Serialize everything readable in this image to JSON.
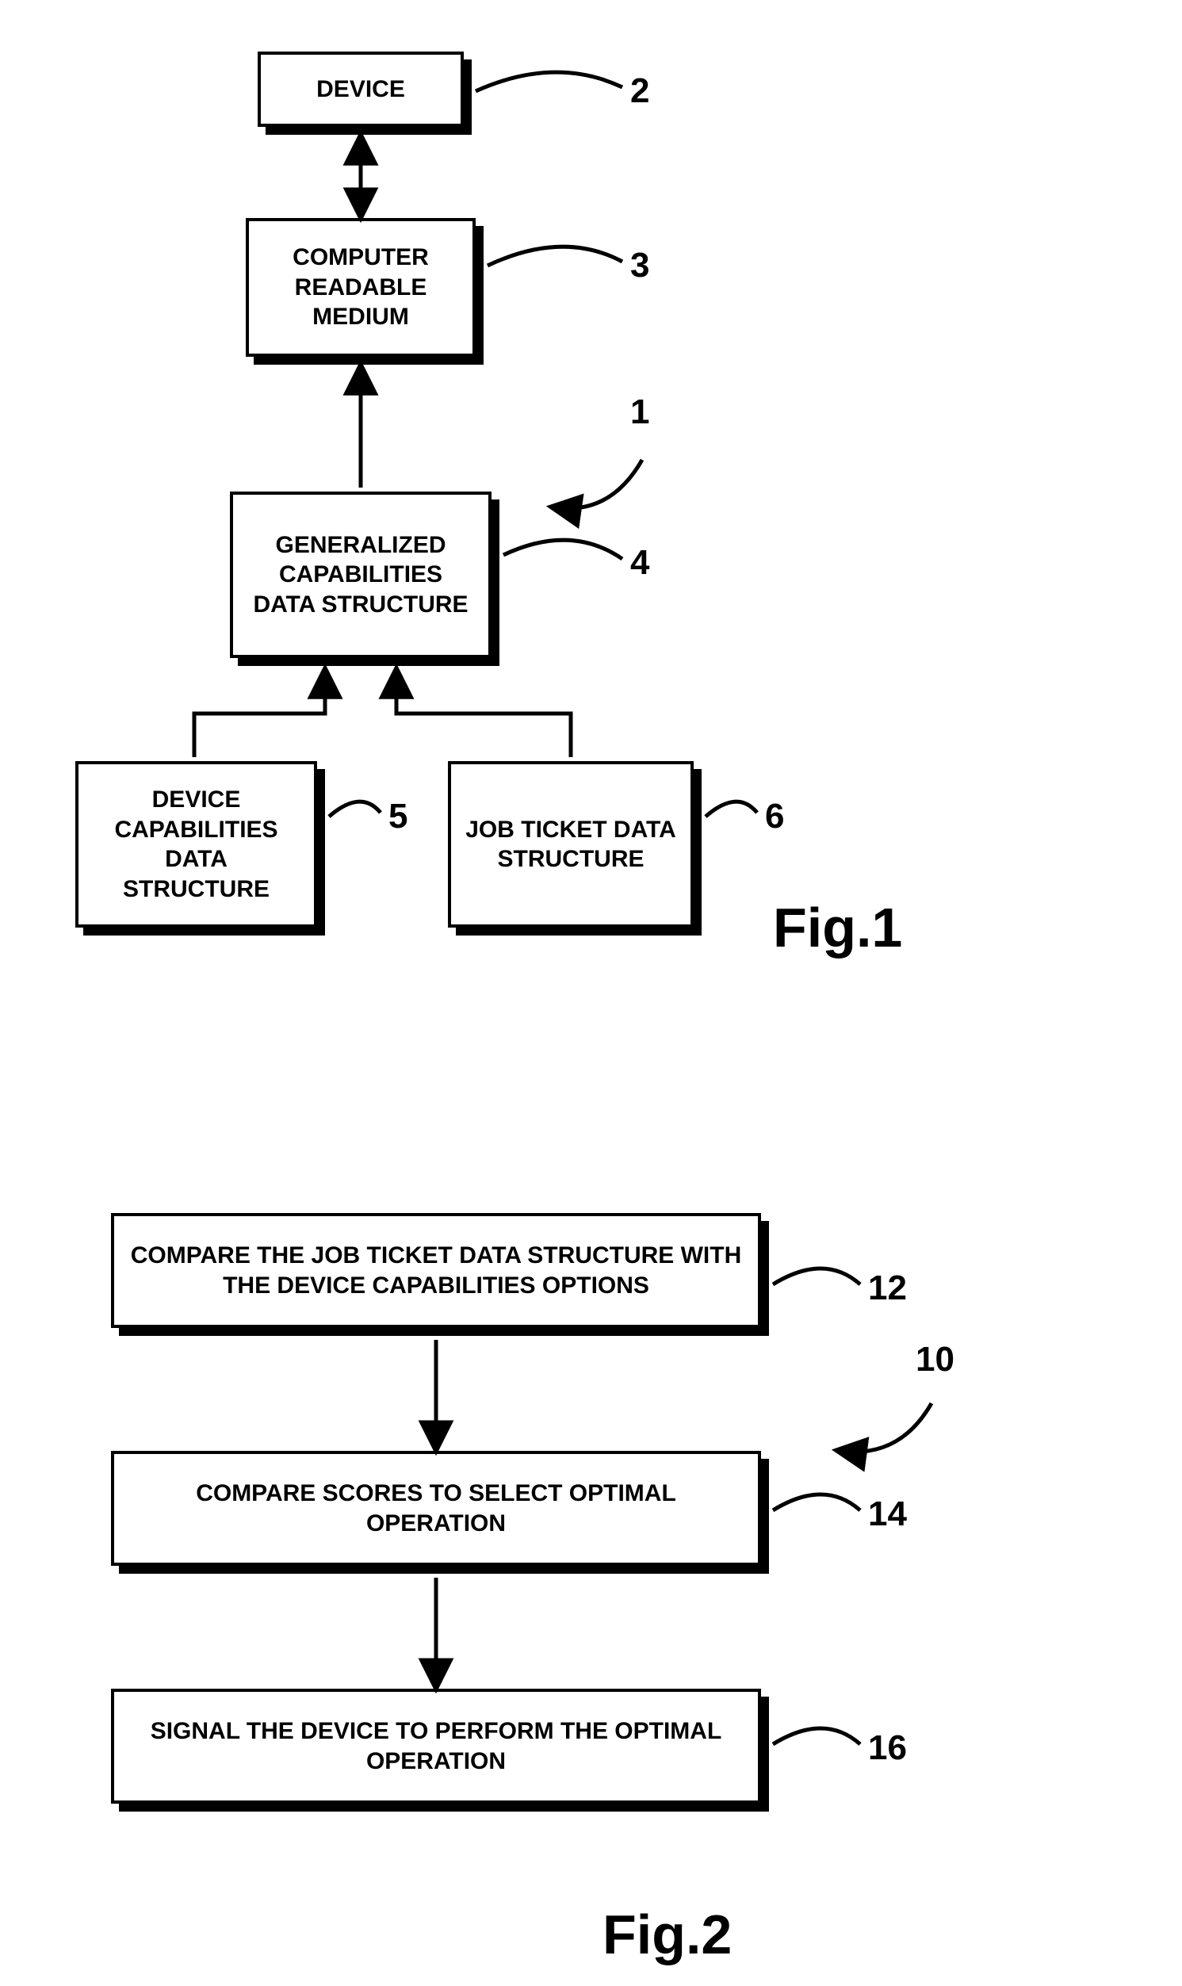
{
  "fig1": {
    "caption": "Fig.1",
    "system_label": "1",
    "boxes": {
      "device": {
        "text": "DEVICE",
        "num": "2"
      },
      "medium": {
        "text": "COMPUTER READABLE MEDIUM",
        "num": "3"
      },
      "gcds": {
        "text": "GENERALIZED CAPABILITIES DATA STRUCTURE",
        "num": "4"
      },
      "dcds": {
        "text": "DEVICE CAPABILITIES DATA STRUCTURE",
        "num": "5"
      },
      "jtds": {
        "text": "JOB TICKET DATA STRUCTURE",
        "num": "6"
      }
    }
  },
  "fig2": {
    "caption": "Fig.2",
    "method_label": "10",
    "boxes": {
      "compare_jt": {
        "text": "COMPARE THE JOB TICKET DATA STRUCTURE WITH THE DEVICE CAPABILITIES OPTIONS",
        "num": "12"
      },
      "compare_scores": {
        "text": "COMPARE SCORES TO SELECT OPTIMAL OPERATION",
        "num": "14"
      },
      "signal": {
        "text": "SIGNAL THE DEVICE TO PERFORM THE OPTIMAL OPERATION",
        "num": "16"
      }
    }
  }
}
